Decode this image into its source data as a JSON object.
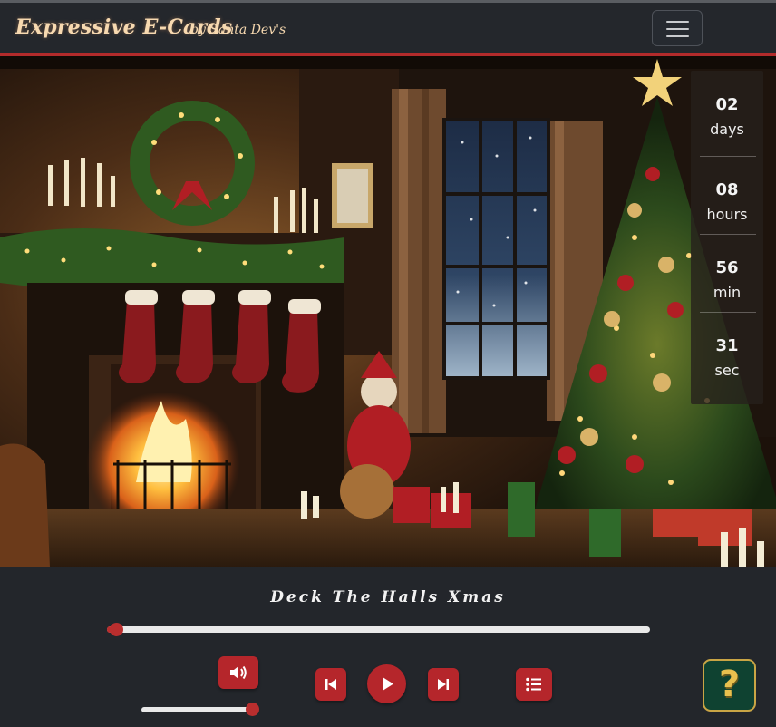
{
  "navbar": {
    "brand": "Expressive E-Cards",
    "brand_by": "by Santa Dev's",
    "menu_icon": "hamburger-icon"
  },
  "scene": {
    "description_icon": "christmas-fireplace-image"
  },
  "countdown": {
    "days": "02",
    "days_label": "days",
    "hours": "08",
    "hours_label": "hours",
    "minutes": "56",
    "minutes_label": "min",
    "seconds": "31",
    "seconds_label": "sec"
  },
  "player": {
    "title": "Deck The Halls Xmas",
    "progress": 0.01,
    "volume": 1.0,
    "icons": {
      "volume": "volume-up-icon",
      "previous": "skip-back-icon",
      "play": "play-icon",
      "next": "skip-forward-icon",
      "playlist": "playlist-icon"
    },
    "accent_color": "#b5262b"
  },
  "help": {
    "label": "?",
    "icon": "help-icon",
    "color": "#0f4231"
  }
}
